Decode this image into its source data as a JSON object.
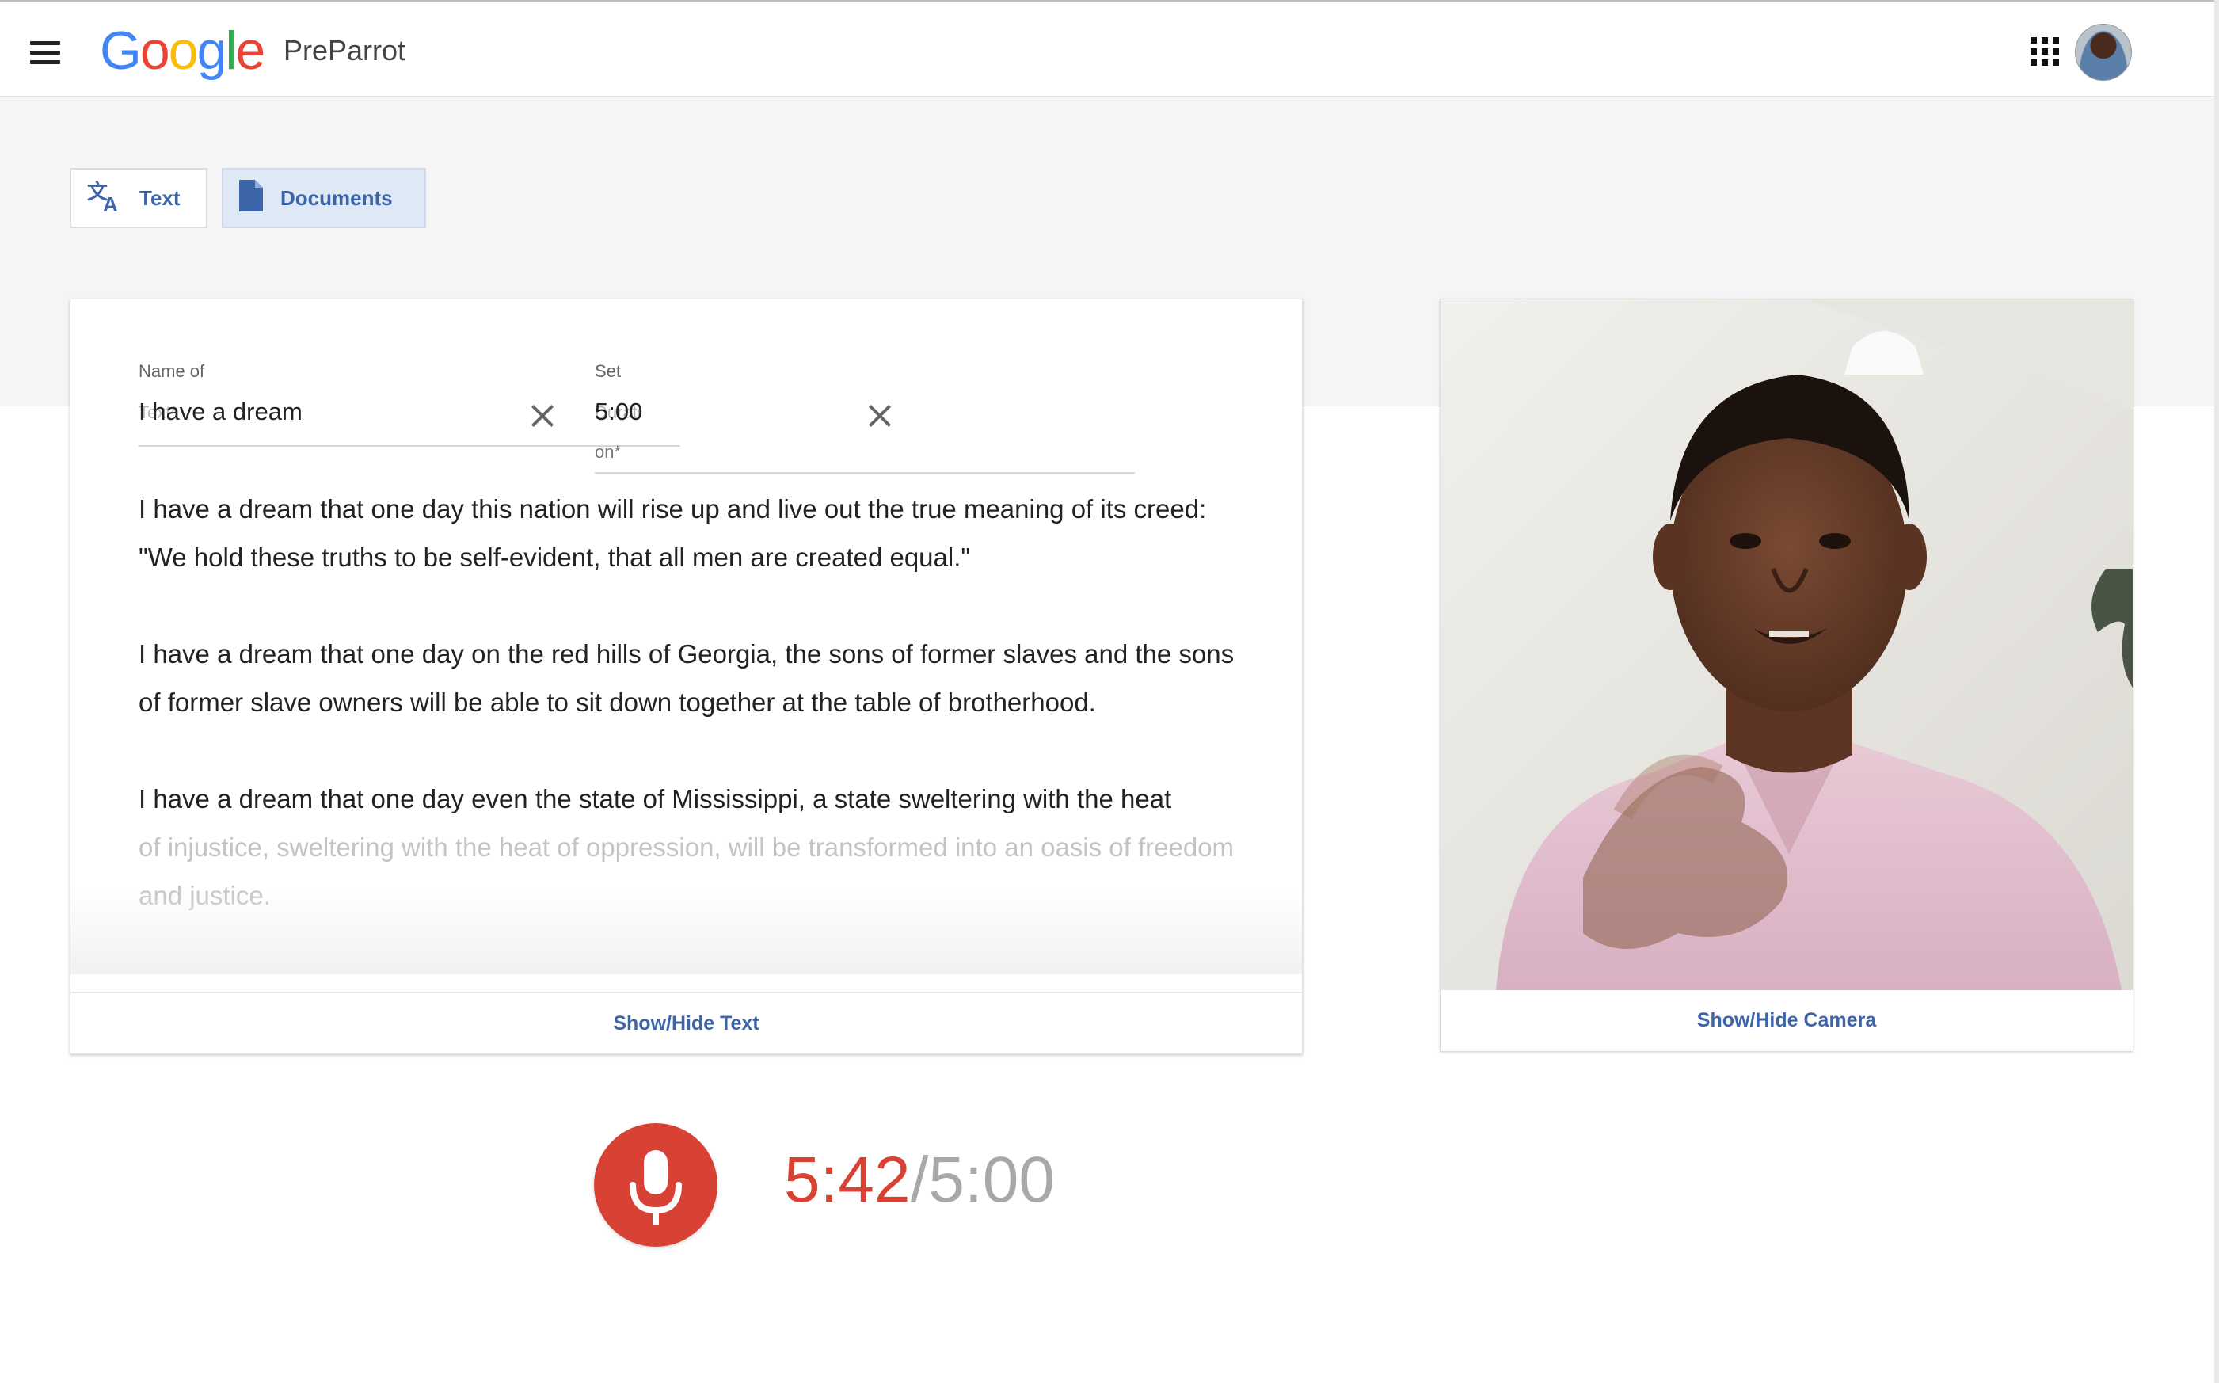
{
  "header": {
    "logo": {
      "letters": [
        "G",
        "o",
        "o",
        "g",
        "l",
        "e"
      ],
      "colors": [
        "#4285f4",
        "#ea4335",
        "#fbbc05",
        "#4285f4",
        "#34a853",
        "#ea4335"
      ]
    },
    "app_name": "PreParrot",
    "menu_icon": "hamburger-menu-icon",
    "apps_icon": "apps-grid-icon",
    "avatar_icon": "user-avatar"
  },
  "tabs": [
    {
      "label": "Text",
      "icon": "translate-icon",
      "selected": false
    },
    {
      "label": "Documents",
      "icon": "document-icon",
      "selected": true
    }
  ],
  "form": {
    "name_label": "Name of",
    "name_sublabel": "Text*",
    "name_value": "I have a dream",
    "duration_label": "Set",
    "duration_sublabel_1": "Durati",
    "duration_sublabel_2": "on*",
    "duration_value": "5:00"
  },
  "speech": {
    "paragraphs": [
      "I have a dream that one day this nation will rise up and live out the true meaning of its creed: \"We hold these truths to be self-evident, that all men are created equal.\"",
      "I have a dream that one day on the red hills of Georgia, the sons of former slaves and the sons of former slave owners will be able to sit down together at the table of brotherhood.",
      "I have a dream that one day even the state of Mississippi, a state sweltering with the heat",
      "of injustice, sweltering with the heat of oppression, will be transformed into an oasis of freedom and justice."
    ]
  },
  "actions": {
    "toggle_text": "Show/Hide Text",
    "toggle_camera": "Show/Hide Camera"
  },
  "recorder": {
    "mic_icon": "microphone-icon",
    "elapsed": "5:42",
    "separator": "/",
    "limit": "5:00",
    "colors": {
      "mic": "#d84234",
      "elapsed": "#d84234",
      "limit": "#a8a8a8"
    }
  },
  "accent_color": "#3c64a8"
}
